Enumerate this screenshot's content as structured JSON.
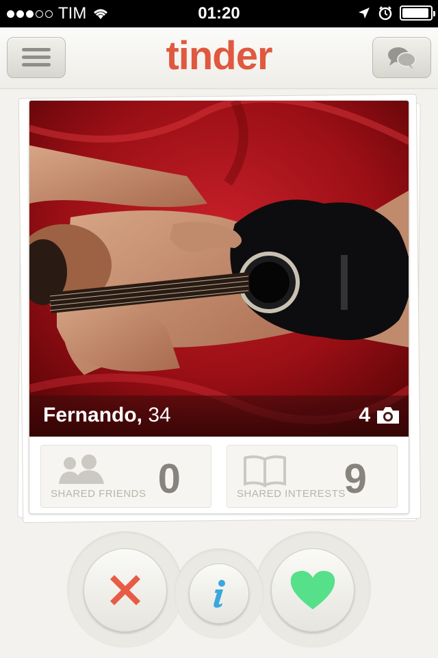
{
  "status_bar": {
    "carrier": "TIM",
    "time": "01:20",
    "signal_bars": 3,
    "signal_max": 5,
    "battery_level": 0.95
  },
  "header": {
    "logo_text": "tinder",
    "menu_icon": "hamburger-menu-icon",
    "chat_icon": "chat-bubbles-icon",
    "brand_color": "#e0583f"
  },
  "profile": {
    "name": "Fernando,",
    "age": "34",
    "photo_count": "4"
  },
  "stats": {
    "shared_friends_label": "SHARED FRIENDS",
    "shared_friends_value": "0",
    "shared_interests_label": "SHARED INTERESTS",
    "shared_interests_value": "9"
  },
  "actions": {
    "nope_icon": "x-icon",
    "info_icon": "info-icon",
    "like_icon": "heart-icon",
    "nope_color": "#e85b45",
    "info_color": "#3aa7df",
    "like_color": "#56e08a"
  }
}
